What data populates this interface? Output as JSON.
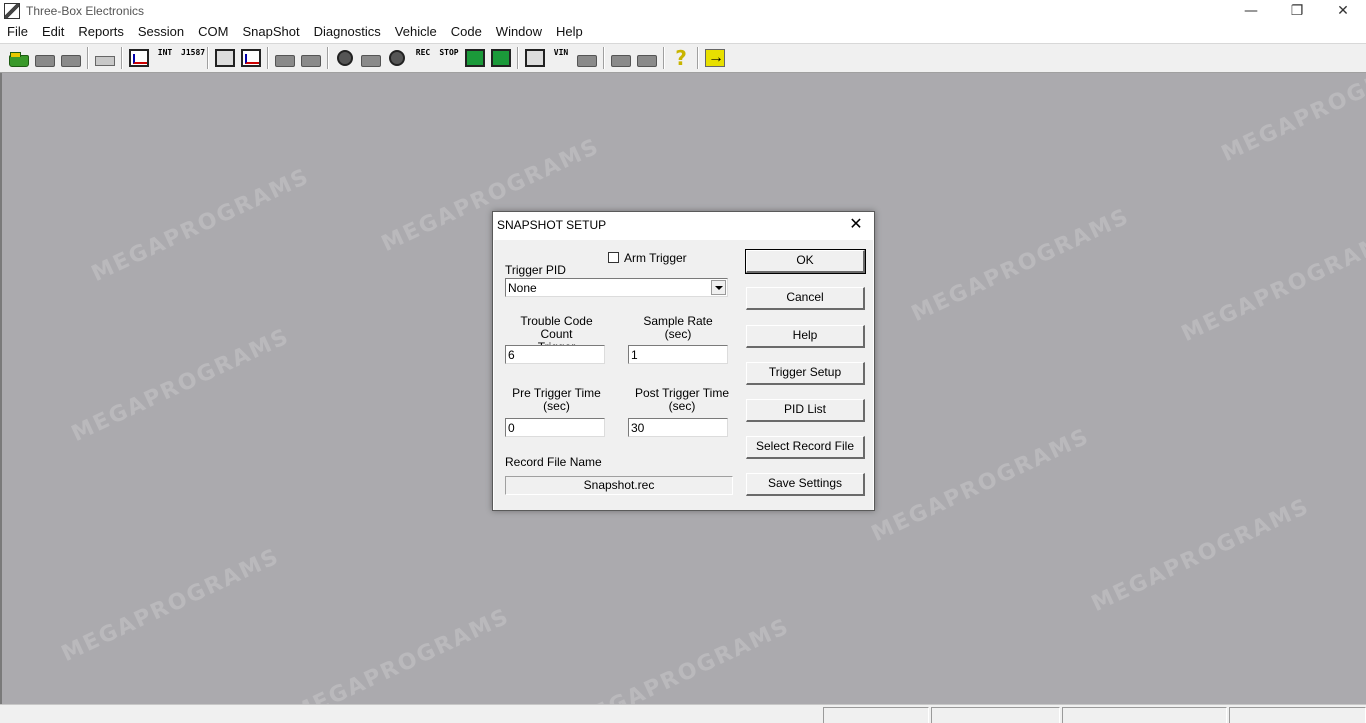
{
  "window": {
    "title": "Three-Box Electronics",
    "minimize": "—",
    "restore": "❐",
    "close": "✕"
  },
  "menu": [
    "File",
    "Edit",
    "Reports",
    "Session",
    "COM",
    "SnapShot",
    "Diagnostics",
    "Vehicle",
    "Code",
    "Window",
    "Help"
  ],
  "toolbar": {
    "int_label": "INT",
    "j1587_label": "J1587",
    "rec_label": "REC",
    "stop_label": "STOP",
    "vin_label": "VIN",
    "help_glyph": "?"
  },
  "watermark": "MEGAPROGRAMS",
  "dialog": {
    "title": "SNAPSHOT SETUP",
    "close": "✕",
    "arm_trigger_label": "Arm Trigger",
    "trigger_pid_label": "Trigger PID",
    "trigger_pid_value": "None",
    "trouble_code_label_1": "Trouble Code Count",
    "trouble_code_label_2": "Trigger",
    "trouble_code_value": "6",
    "sample_rate_label_1": "Sample Rate",
    "sample_rate_label_2": "(sec)",
    "sample_rate_value": "1",
    "pre_trigger_label_1": "Pre Trigger Time",
    "pre_trigger_label_2": "(sec)",
    "pre_trigger_value": "0",
    "post_trigger_label_1": "Post Trigger Time",
    "post_trigger_label_2": "(sec)",
    "post_trigger_value": "30",
    "record_file_label": "Record File Name",
    "record_file_value": "Snapshot.rec",
    "buttons": {
      "ok": "OK",
      "cancel": "Cancel",
      "help": "Help",
      "trigger_setup": "Trigger Setup",
      "pid_list": "PID List",
      "select_record_file": "Select Record File",
      "save_settings": "Save Settings"
    }
  }
}
